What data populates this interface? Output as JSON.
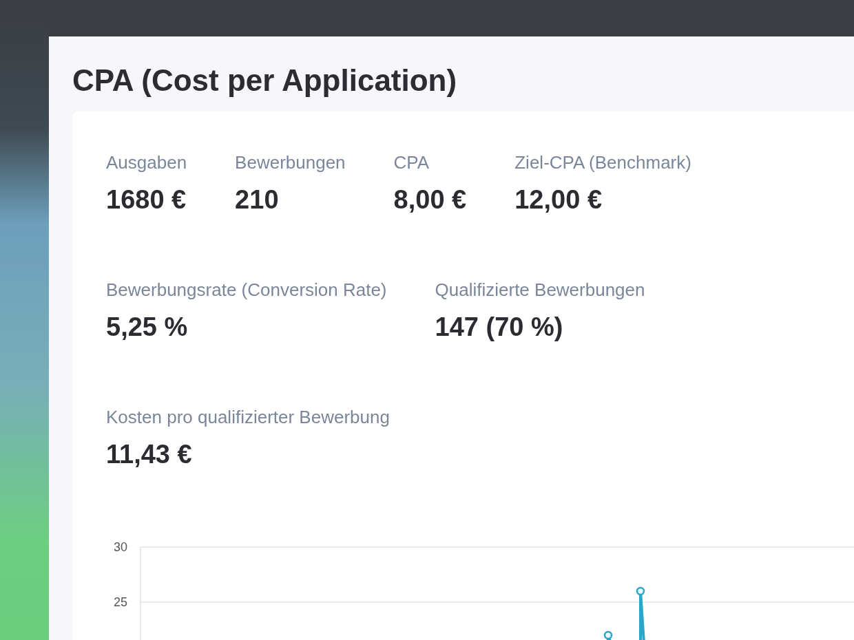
{
  "page": {
    "title": "CPA (Cost per Application)"
  },
  "stats": [
    [
      {
        "label": "Ausgaben",
        "value": "1680 €"
      },
      {
        "label": "Bewerbungen",
        "value": "210"
      },
      {
        "label": "CPA",
        "value": "8,00 €"
      },
      {
        "label": "Ziel-CPA (Benchmark)",
        "value": "12,00 €"
      }
    ],
    [
      {
        "label": "Bewerbungsrate (Conversion Rate)",
        "value": "5,25 %"
      },
      {
        "label": "Qualifizierte Bewerbungen",
        "value": "147 (70 %)"
      }
    ],
    [
      {
        "label": "Kosten pro qualifizierter Bewerbung",
        "value": "11,43 €"
      }
    ]
  ],
  "chart": {
    "y_axis_labels": [
      "30",
      "25"
    ]
  }
}
